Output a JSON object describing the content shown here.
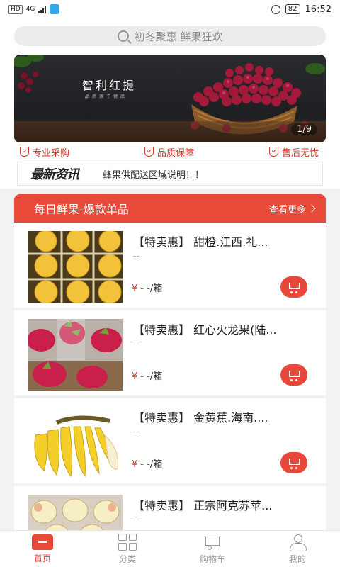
{
  "status_bar": {
    "network": "HD",
    "signal": "4G",
    "battery": "82",
    "time": "16:52"
  },
  "search": {
    "placeholder": "初冬聚惠 鲜果狂欢"
  },
  "banner": {
    "title": "智利红提",
    "subtitle": "品质源于健康",
    "index": "1/9"
  },
  "features": [
    {
      "label": "专业采购"
    },
    {
      "label": "品质保障"
    },
    {
      "label": "售后无忧"
    }
  ],
  "news": {
    "logo_text": "最新资讯",
    "message": "蜂果供配送区域说明！！"
  },
  "section": {
    "title": "每日鲜果-爆款单品",
    "more_label": "查看更多"
  },
  "products": [
    {
      "name": "【特卖惠】 甜橙.江西.礼...",
      "desc": "--",
      "price": "¥ - -",
      "unit": "/箱",
      "image": "oranges-in-box"
    },
    {
      "name": "【特卖惠】 红心火龙果(陆...",
      "desc": "--",
      "price": "¥ - -",
      "unit": "/箱",
      "image": "dragon-fruit"
    },
    {
      "name": "【特卖惠】 金黄蕉.海南....",
      "desc": "--",
      "price": "¥ - -",
      "unit": "/箱",
      "image": "bananas"
    },
    {
      "name": "【特卖惠】 正宗阿克苏苹...",
      "desc": "--",
      "price": "",
      "unit": "",
      "image": "apples"
    }
  ],
  "tabbar": [
    {
      "label": "首页",
      "icon": "home-icon",
      "active": true
    },
    {
      "label": "分类",
      "icon": "grid-icon",
      "active": false
    },
    {
      "label": "购物车",
      "icon": "cart-icon",
      "active": false
    },
    {
      "label": "我的",
      "icon": "user-icon",
      "active": false
    }
  ],
  "colors": {
    "accent": "#e84a3a",
    "price": "#e23a2b"
  }
}
